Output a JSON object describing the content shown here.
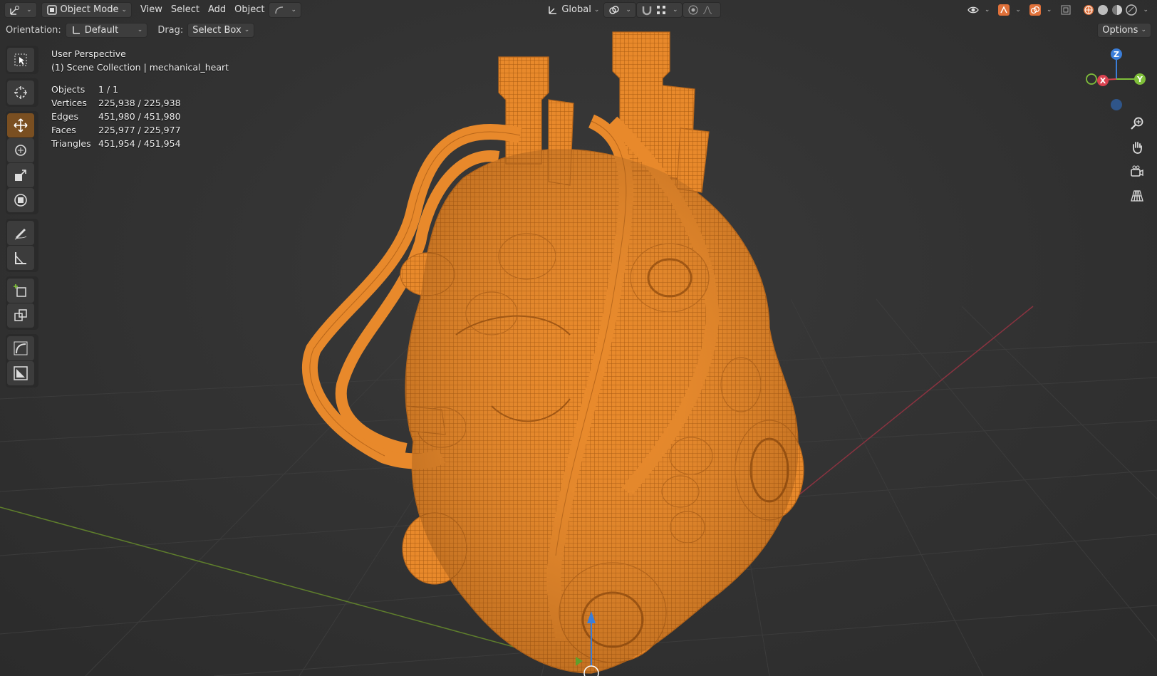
{
  "header": {
    "editor_type_icon": "transform-editor-icon",
    "mode_label": "Object Mode",
    "menus": [
      "View",
      "Select",
      "Add",
      "Object"
    ],
    "transform_orientation": "Global",
    "options_label": "Options"
  },
  "tool_settings": {
    "orientation_label": "Orientation:",
    "orientation_value": "Default",
    "drag_label": "Drag:",
    "drag_value": "Select Box"
  },
  "overlay": {
    "view_name": "User Perspective",
    "collection_line": "(1) Scene Collection | mechanical_heart",
    "stats": [
      {
        "key": "Objects",
        "value": "1 / 1"
      },
      {
        "key": "Vertices",
        "value": "225,938 / 225,938"
      },
      {
        "key": "Edges",
        "value": "451,980 / 451,980"
      },
      {
        "key": "Faces",
        "value": "225,977 / 225,977"
      },
      {
        "key": "Triangles",
        "value": "451,954 / 451,954"
      }
    ]
  },
  "gizmo": {
    "x": "X",
    "y": "Y",
    "z": "Z"
  },
  "tools": [
    {
      "name": "select-box-tool",
      "icon": "select-box-icon",
      "active": false
    },
    {
      "name": "cursor-tool",
      "icon": "cursor-icon",
      "active": false
    },
    {
      "name": "move-tool",
      "icon": "move-icon",
      "active": true
    },
    {
      "name": "rotate-tool",
      "icon": "rotate-icon",
      "active": false
    },
    {
      "name": "scale-tool",
      "icon": "scale-icon",
      "active": false
    },
    {
      "name": "transform-tool",
      "icon": "transform-icon",
      "active": false
    },
    {
      "name": "annotate-tool",
      "icon": "annotate-icon",
      "active": false
    },
    {
      "name": "measure-tool",
      "icon": "measure-icon",
      "active": false
    },
    {
      "name": "add-cube-tool",
      "icon": "add-cube-icon",
      "active": false
    },
    {
      "name": "extrude-tool",
      "icon": "extrude-icon",
      "active": false
    },
    {
      "name": "curve-tool",
      "icon": "curve-icon",
      "active": false
    },
    {
      "name": "image-tool",
      "icon": "image-icon",
      "active": false
    }
  ],
  "colors": {
    "accent": "#e8892b",
    "active_tool": "#7a4f21",
    "axis_x": "#d9414f",
    "axis_y": "#7fbf3a",
    "axis_z": "#3b7ed9",
    "mesh": "#f0922e"
  }
}
